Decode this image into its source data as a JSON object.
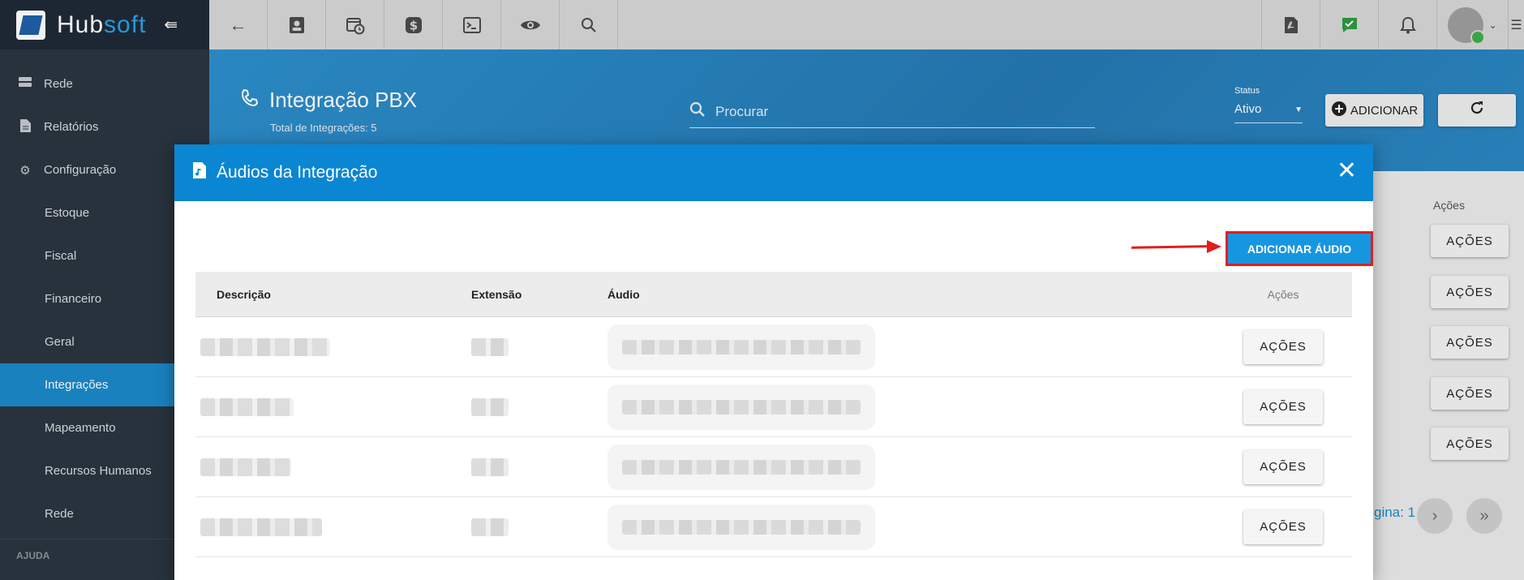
{
  "app": {
    "logo_main": "Hub",
    "logo_accent": "soft"
  },
  "topbar": {
    "left_icons": [
      "back-arrow-icon",
      "contact-card-icon",
      "calendar-clock-icon",
      "dollar-icon",
      "terminal-icon",
      "eye-icon",
      "search-icon"
    ],
    "right_icons": [
      "pdf-icon",
      "chat-check-icon",
      "bell-icon"
    ]
  },
  "sidebar": {
    "items": [
      {
        "label": "Rede",
        "icon": "server-icon",
        "sub": false,
        "active": false
      },
      {
        "label": "Relatórios",
        "icon": "document-icon",
        "sub": false,
        "active": false
      },
      {
        "label": "Configuração",
        "icon": "gear-icon",
        "sub": false,
        "active": false
      },
      {
        "label": "Estoque",
        "sub": true,
        "active": false
      },
      {
        "label": "Fiscal",
        "sub": true,
        "active": false
      },
      {
        "label": "Financeiro",
        "sub": true,
        "active": false
      },
      {
        "label": "Geral",
        "sub": true,
        "active": false
      },
      {
        "label": "Integrações",
        "sub": true,
        "active": true
      },
      {
        "label": "Mapeamento",
        "sub": true,
        "active": false
      },
      {
        "label": "Recursos Humanos",
        "sub": true,
        "active": false
      },
      {
        "label": "Rede",
        "sub": true,
        "active": false
      }
    ],
    "section_heading": "AJUDA"
  },
  "page": {
    "title": "Integração PBX",
    "subtitle": "Total de Integrações: 5",
    "search_placeholder": "Procurar",
    "status_label": "Status",
    "status_value": "Ativo",
    "add_button": "ADICIONAR",
    "background_actions_header": "Ações",
    "background_action_label": "AÇÕES",
    "pagination_text": "gina: 1"
  },
  "modal": {
    "title": "Áudios da Integração",
    "add_audio_button": "ADICIONAR ÁUDIO",
    "columns": {
      "description": "Descrição",
      "extension": "Extensão",
      "audio": "Áudio",
      "actions": "Ações"
    },
    "row_action_label": "AÇÕES"
  },
  "colors": {
    "primary": "#0a86d2",
    "sidebar_bg": "#2b3540",
    "highlight_border": "#e21d1d"
  }
}
